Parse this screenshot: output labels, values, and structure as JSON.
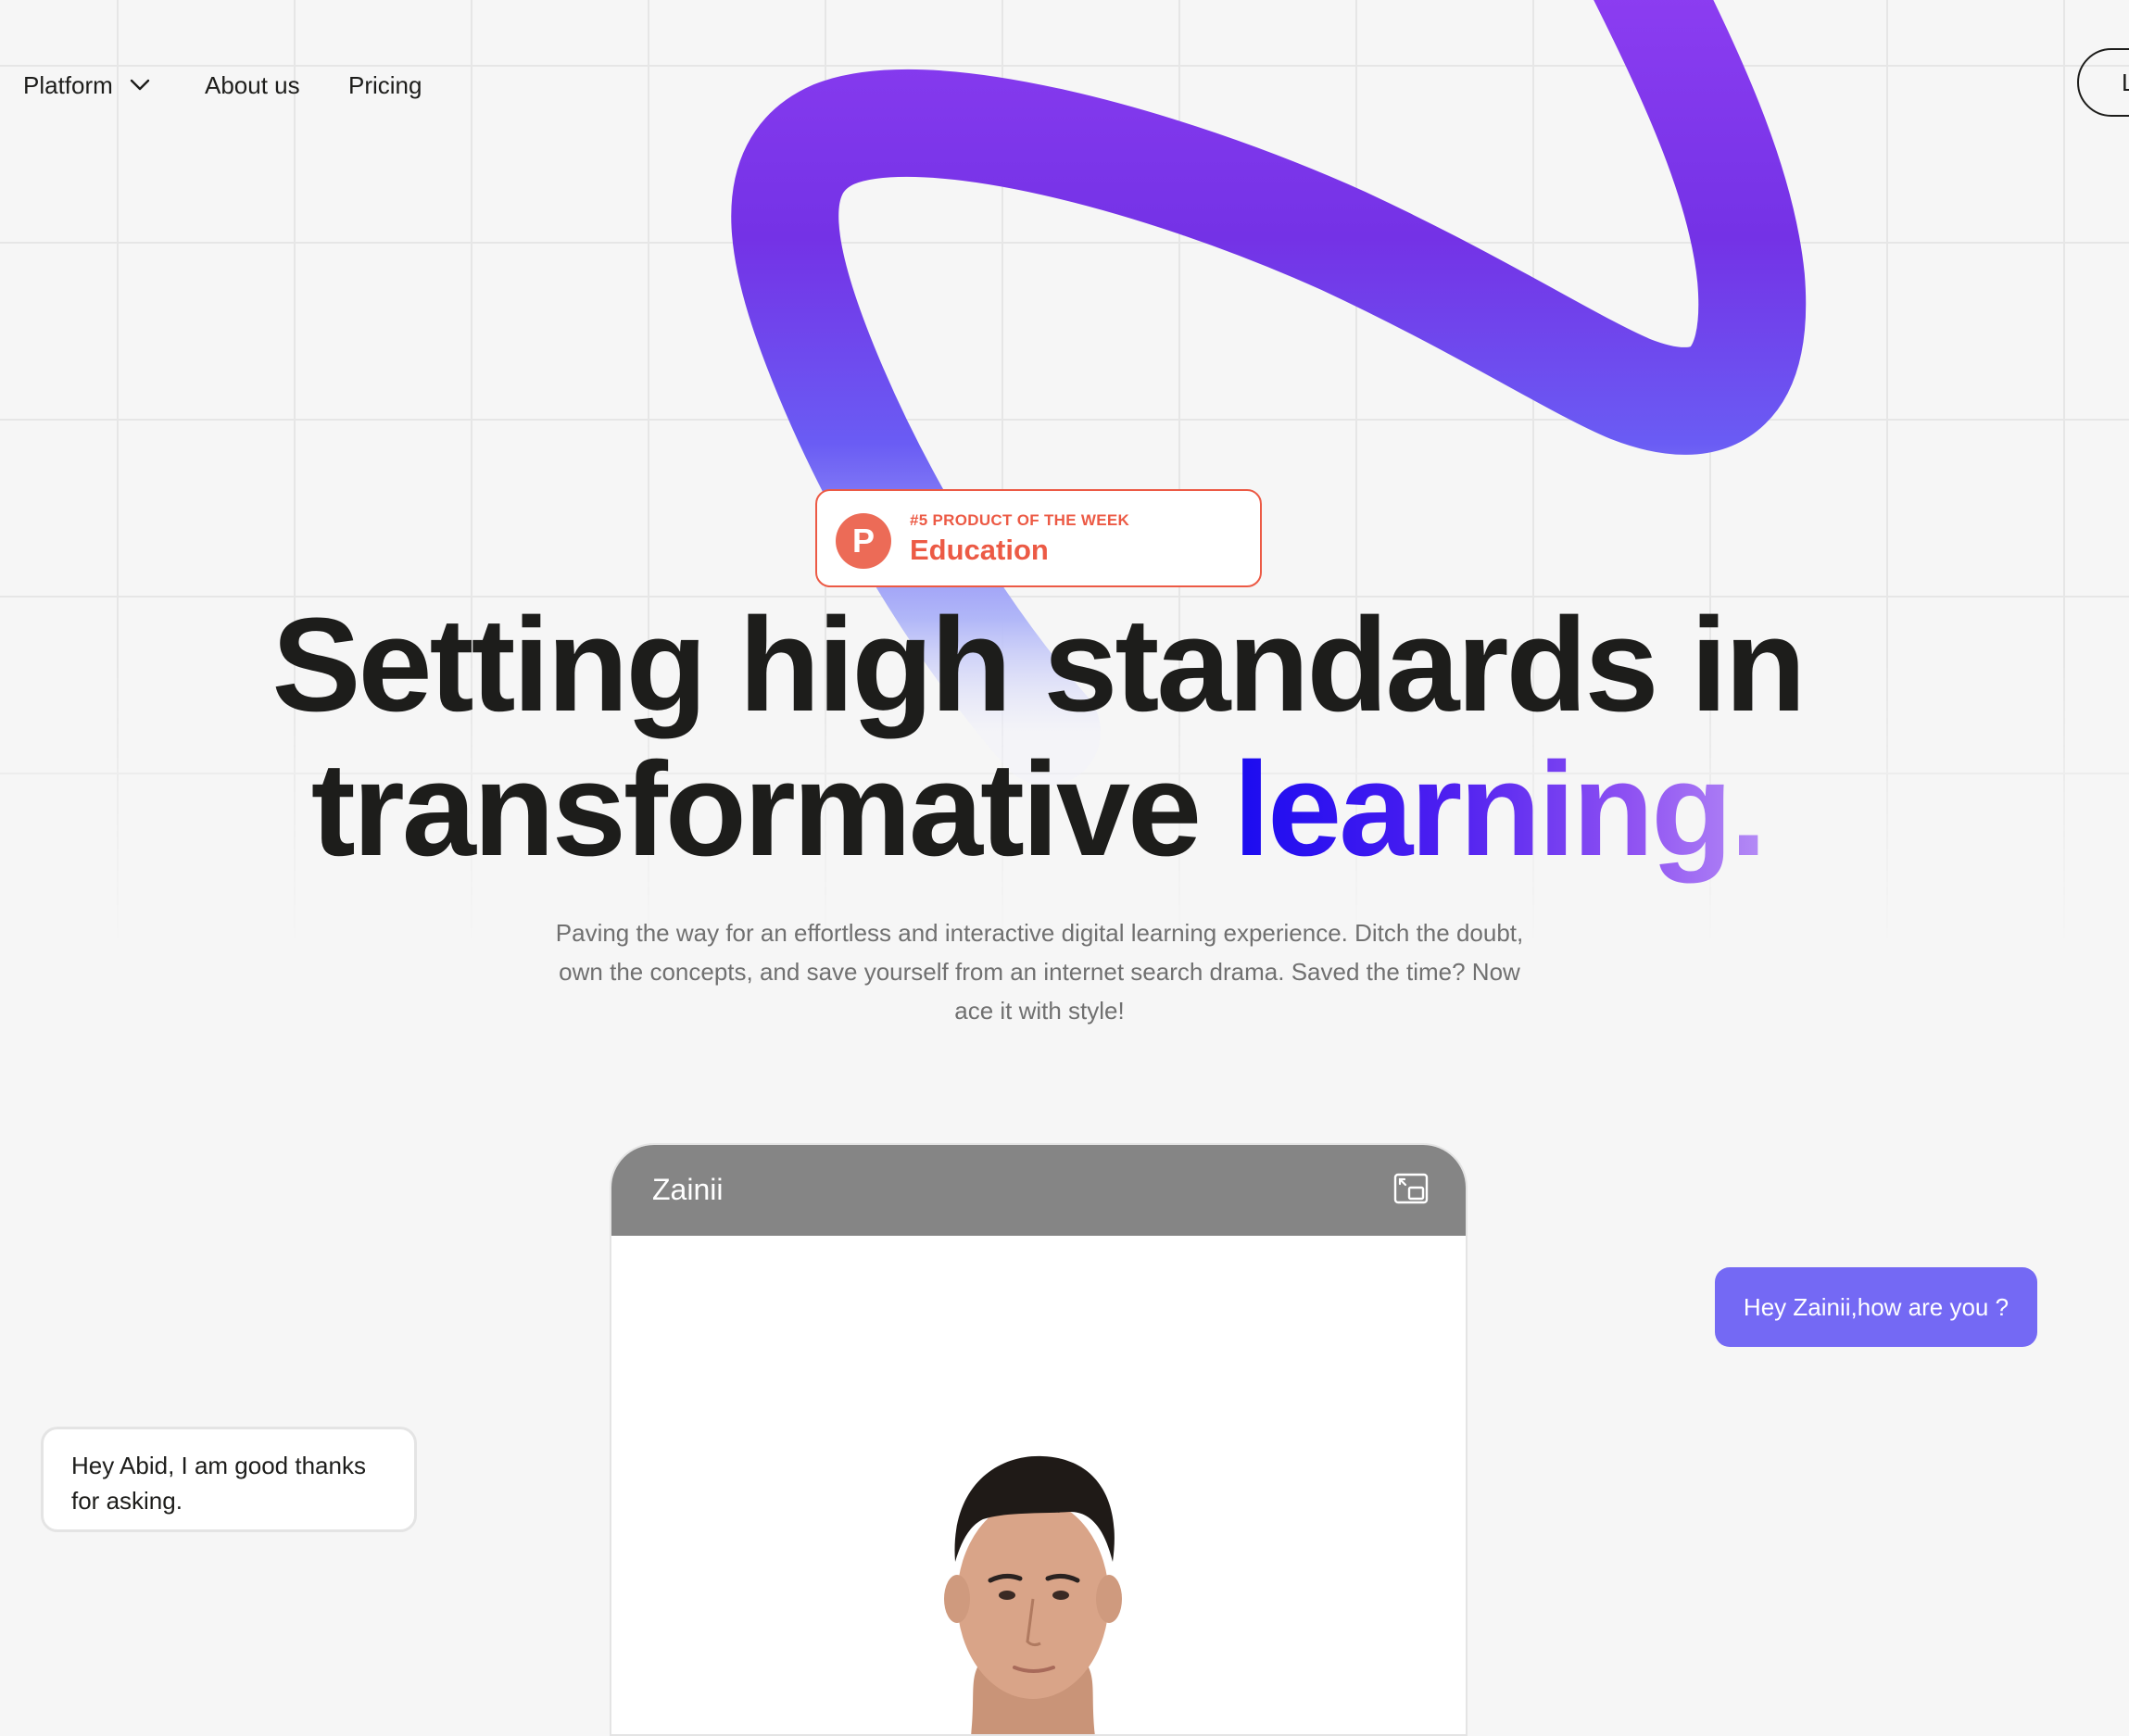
{
  "nav": {
    "items": [
      {
        "label": "Platform",
        "has_dropdown": true
      },
      {
        "label": "About us"
      },
      {
        "label": "Pricing"
      }
    ],
    "login_label": "L"
  },
  "badge": {
    "logo_letter": "P",
    "kicker": "#5 PRODUCT OF THE WEEK",
    "title": "Education"
  },
  "hero": {
    "line1": "Setting high standards in",
    "line2_plain": "transformative ",
    "line2_accent": "learning.",
    "subtitle": "Paving the way for an effortless and interactive digital learning experience.  Ditch the doubt, own the concepts, and save yourself from an internet search drama. Saved the time? Now ace it with style!"
  },
  "chat": {
    "window_title": "Zainii",
    "user_message": "Hey Zainii,how are you ?",
    "bot_message": "Hey Abid, I am good thanks for asking."
  },
  "icons": {
    "dropdown": "chevron-down-icon",
    "badge": "product-hunt-icon",
    "window": "picture-in-picture-icon"
  },
  "colors": {
    "background": "#f6f6f6",
    "text": "#1d1d1b",
    "accent_blue": "#1a0bf0",
    "accent_purple": "#8f52f2",
    "badge_red": "#ec5a45",
    "chat_header": "#858585",
    "user_bubble": "#7469f4"
  }
}
